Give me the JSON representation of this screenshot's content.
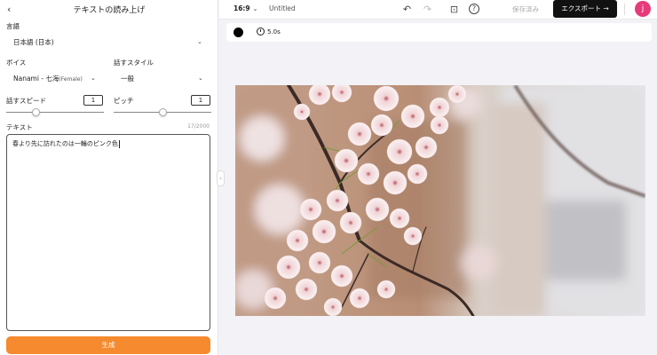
{
  "panel": {
    "title": "テキストの読み上げ",
    "language_label": "言語",
    "language_value": "日本語 (日本)",
    "voice_label": "ボイス",
    "voice_name": "Nanami - 七海",
    "voice_gender": "(Female)",
    "style_label": "話すスタイル",
    "style_value": "一般",
    "speed_label": "話すスピード",
    "speed_value": "1",
    "speed_level": 0.3,
    "pitch_label": "ピッチ",
    "pitch_value": "1",
    "pitch_level": 0.5,
    "text_label": "テキスト",
    "counter": "17/2000",
    "text_value": "春より先に訪れたのは一輪のピンク色",
    "generate_label": "生成"
  },
  "topbar": {
    "ratio": "16:9",
    "doc_title": "Untitled",
    "saved": "保存済み",
    "export_label": "エクスポート →",
    "avatar_initial": "j"
  },
  "scene": {
    "duration": "5.0s"
  },
  "colors": {
    "accent": "#f58a2e",
    "export_bg": "#111111",
    "avatar": "#e63b7a"
  }
}
